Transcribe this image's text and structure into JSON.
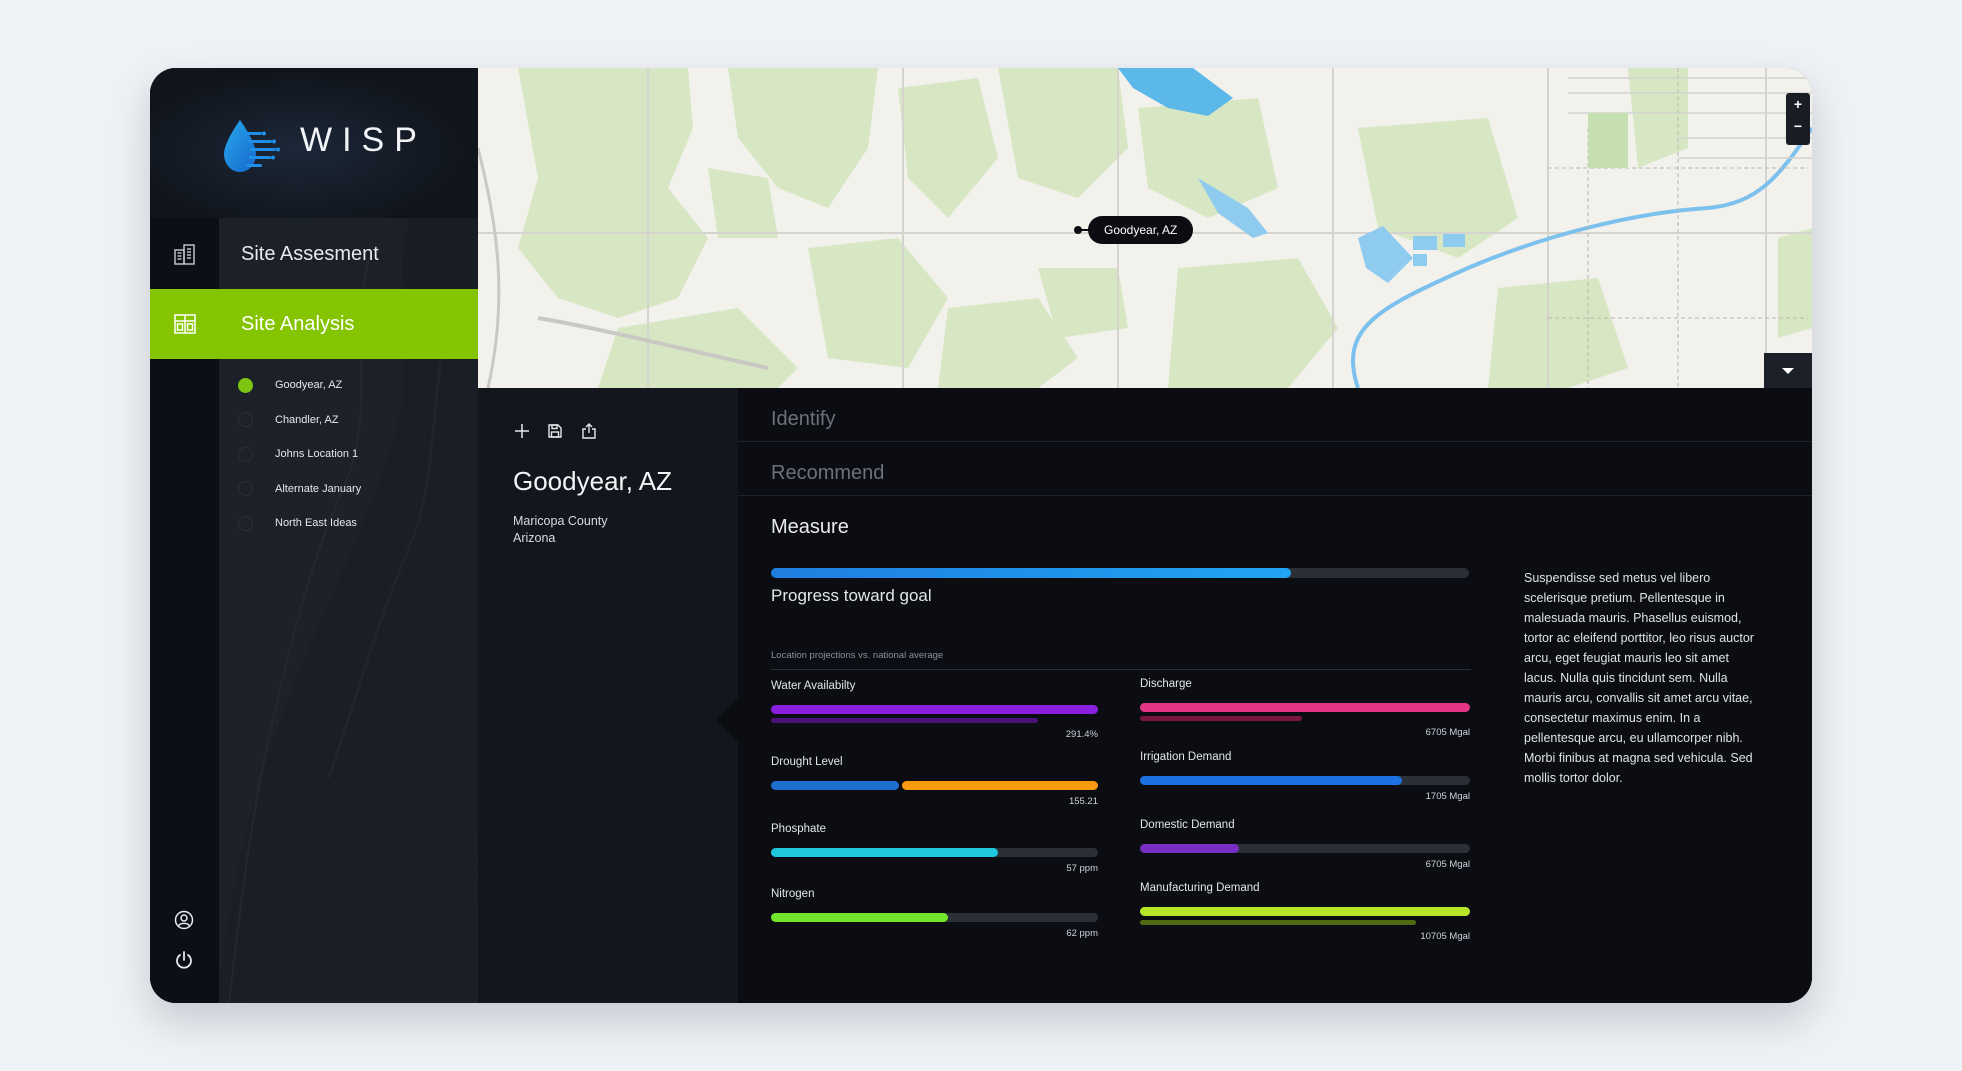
{
  "app": {
    "logo_text": "WISP"
  },
  "nav": {
    "site_assessment": "Site Assesment",
    "site_analysis": "Site Analysis"
  },
  "sites": [
    {
      "label": "Goodyear, AZ",
      "active": true
    },
    {
      "label": "Chandler, AZ",
      "active": false
    },
    {
      "label": "Johns Location 1",
      "active": false
    },
    {
      "label": "Alternate January",
      "active": false
    },
    {
      "label": "North East Ideas",
      "active": false
    }
  ],
  "map": {
    "pin_label": "Goodyear, AZ",
    "zoom_in": "+",
    "zoom_out": "−"
  },
  "detail": {
    "title": "Goodyear, AZ",
    "county": "Maricopa County",
    "state": "Arizona"
  },
  "sections": {
    "identify": "Identify",
    "recommend": "Recommend",
    "measure": "Measure"
  },
  "goal": {
    "label": "Progress toward goal",
    "progress": 0.745
  },
  "projections": {
    "label": "Location projections vs. national average"
  },
  "metrics_left": [
    {
      "label": "Water Availabilty",
      "value": "291.4%",
      "fill": 1.0,
      "color": "#8a1fe0",
      "sub_fill": 0.815,
      "sub_color": "#4a1277"
    },
    {
      "label": "Drought Level",
      "value": "155.21",
      "fill": 0.39,
      "color": "#1e6fd0",
      "split_color": "#f79a0e"
    },
    {
      "label": "Phosphate",
      "value": "57 ppm",
      "fill": 0.695,
      "color": "#1fc7dd"
    },
    {
      "label": "Nitrogen",
      "value": "62 ppm",
      "fill": 0.54,
      "color": "#72e62a"
    }
  ],
  "metrics_right": [
    {
      "label": "Discharge",
      "value": "6705 Mgal",
      "fill": 1.0,
      "color": "#e23583",
      "sub_fill": 0.49,
      "sub_color": "#7a1740"
    },
    {
      "label": "Irrigation Demand",
      "value": "1705 Mgal",
      "fill": 0.795,
      "color": "#1c72e0"
    },
    {
      "label": "Domestic Demand",
      "value": "6705 Mgal",
      "fill": 0.3,
      "color": "#7a2fc4"
    },
    {
      "label": "Manufacturing Demand",
      "value": "10705 Mgal",
      "fill": 1.0,
      "color": "#b6e52a",
      "sub_fill": 0.835,
      "sub_color": "#4f6b12"
    }
  ],
  "paragraph": "Suspendisse sed metus vel libero scelerisque pretium. Pellentesque in malesuada mauris. Phasellus euismod, tortor ac eleifend porttitor, leo risus auctor arcu, eget feugiat mauris leo sit amet lacus. Nulla quis tincidunt sem. Nulla mauris arcu, convallis sit amet arcu vitae, consectetur maximus enim. In a pellentesque arcu, eu ullamcorper nibh. Morbi finibus at magna sed vehicula. Sed mollis tortor dolor.",
  "colors": {
    "accent": "#84c400",
    "panel": "#0b0d13",
    "sidebar": "#141820"
  },
  "icons": {
    "assess": "building-icon",
    "analysis": "grid-icon",
    "user": "user-circle-icon",
    "power": "power-icon",
    "add": "plus-icon",
    "save": "save-icon",
    "share": "share-icon",
    "map_toggle": "chevron-down-icon"
  }
}
